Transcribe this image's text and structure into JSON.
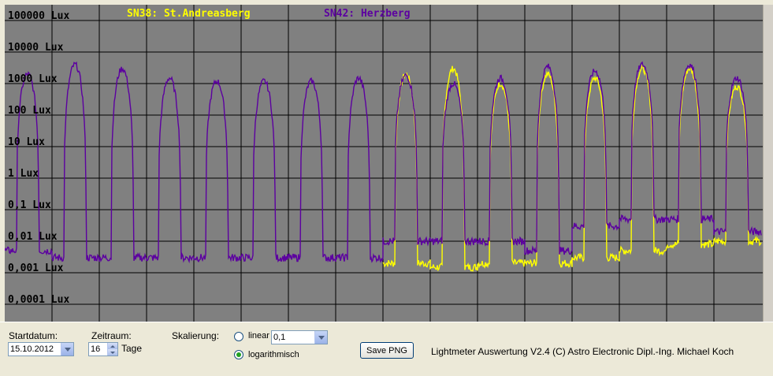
{
  "chart_data": {
    "type": "line",
    "legend": [
      {
        "name": "SN38: St.Andreasberg",
        "color": "#ffff00"
      },
      {
        "name": "SN42: Herzberg",
        "color": "#5c00a0"
      }
    ],
    "y_scale": "log",
    "ylim": [
      0.0001,
      100000
    ],
    "y_ticks": [
      "100000 Lux",
      "10000 Lux",
      "1000 Lux",
      "100 Lux",
      "10 Lux",
      "1 Lux",
      "0,1 Lux",
      "0,01 Lux",
      "0,001 Lux",
      "0,0001 Lux"
    ],
    "grid": true,
    "days": 16,
    "series": [
      {
        "name": "SN38: St.Andreasberg",
        "color": "#ffff00",
        "start_day": 8,
        "day_peaks_lux": [
          2000,
          3000,
          1000,
          2000,
          1500,
          3000,
          3000,
          800
        ],
        "night_min_lux": [
          0.002,
          0.0015,
          0.002,
          0.002,
          0.003,
          0.005,
          0.008,
          0.01
        ]
      },
      {
        "name": "SN42: Herzberg",
        "color": "#5c00a0",
        "start_day": 0,
        "day_peaks_lux": [
          2000,
          4000,
          3000,
          1500,
          1200,
          1200,
          1200,
          1500,
          1800,
          1000,
          1500,
          3500,
          2500,
          4000,
          4000,
          1500
        ],
        "night_min_lux": [
          0.005,
          0.003,
          0.003,
          0.003,
          0.003,
          0.003,
          0.003,
          0.003,
          0.01,
          0.01,
          0.01,
          0.005,
          0.03,
          0.05,
          0.05,
          0.02
        ]
      }
    ]
  },
  "controls": {
    "startdatum_label": "Startdatum:",
    "startdatum_value": "15.10.2012",
    "zeitraum_label": "Zeitraum:",
    "zeitraum_value": "16",
    "zeitraum_unit": "Tage",
    "skalierung_label": "Skalierung:",
    "linear_label": "linear",
    "linear_value": "0,1",
    "log_label": "logarithmisch",
    "save_label": "Save PNG",
    "footer_text": "Lightmeter Auswertung V2.4  (C) Astro Electronic Dipl.-Ing. Michael Koch"
  },
  "colors": {
    "plot_bg": "#808080",
    "grid": "#000000",
    "sn38": "#ffff00",
    "sn42": "#5c00a0"
  }
}
